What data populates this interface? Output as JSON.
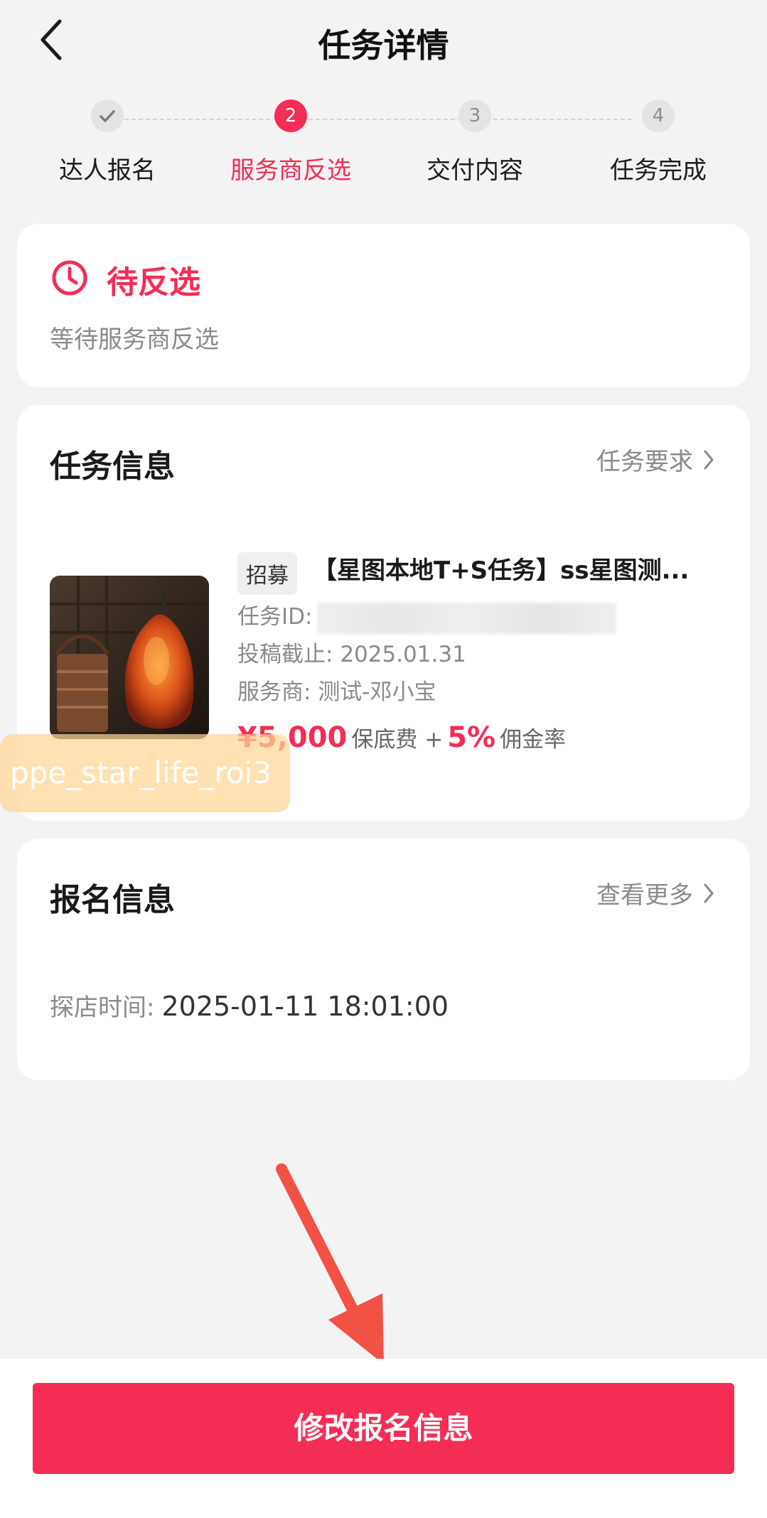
{
  "header": {
    "title": "任务详情"
  },
  "steps": [
    {
      "number": "",
      "label": "达人报名",
      "state": "done"
    },
    {
      "number": "2",
      "label": "服务商反选",
      "state": "active"
    },
    {
      "number": "3",
      "label": "交付内容",
      "state": "pending"
    },
    {
      "number": "4",
      "label": "任务完成",
      "state": "pending"
    }
  ],
  "status": {
    "title": "待反选",
    "desc": "等待服务商反选"
  },
  "task": {
    "section_title": "任务信息",
    "link": "任务要求",
    "tag": "招募",
    "name": "【星图本地T+S任务】ss星图测...",
    "id_label": "任务ID:",
    "deadline_label": "投稿截止:",
    "deadline": "2025.01.31",
    "provider_label": "服务商:",
    "provider": "测试-邓小宝",
    "price": "¥5,000",
    "price_unit": "保底费 +",
    "rate": "5%",
    "rate_unit": "佣金率"
  },
  "overlay_label": "ppe_star_life_roi3",
  "signup": {
    "section_title": "报名信息",
    "link": "查看更多",
    "time_label": "探店时间:",
    "time_value": "2025-01-11 18:01:00"
  },
  "footer": {
    "button": "修改报名信息"
  },
  "colors": {
    "accent": "#f42d55",
    "arrow": "#f25146"
  },
  "icons": {
    "back": "chevron-left-icon",
    "status": "clock-icon",
    "link": "chevron-right-icon",
    "step_done": "check-icon"
  }
}
